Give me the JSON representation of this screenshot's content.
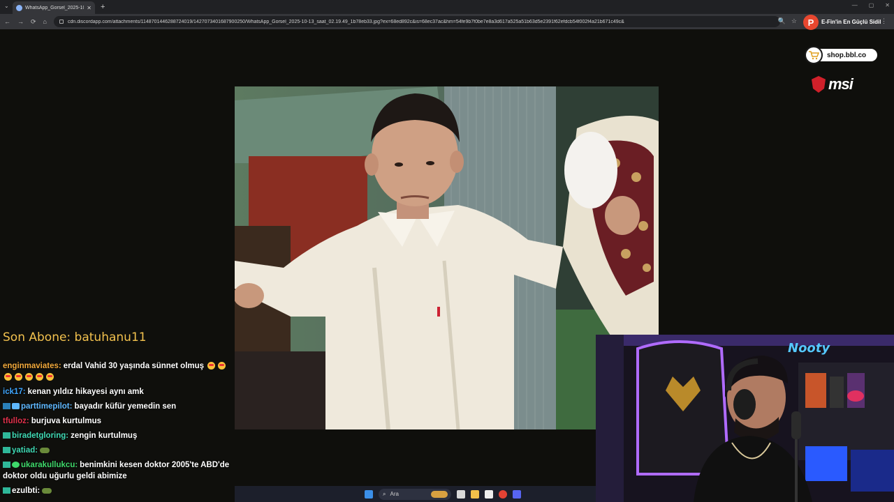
{
  "browser": {
    "tab_title": "WhatsApp_Gorsel_2025-10-13...",
    "tab_close": "✕",
    "new_tab": "+",
    "url": "cdn.discordapp.com/attachments/1148701446288724019/1427073401687900250/WhatsApp_Gorsel_2025-10-13_saat_02.19.49_1b78eb33.jpg?ex=68ed892c&is=68ec37ac&hm=54fe9b7f0be7e8a3d617a525a51b63d5e2391f62efdcb54f002f4a21b671c49c&",
    "back": "←",
    "forward": "→",
    "reload": "⟳",
    "home": "⌂",
    "zoom": "🔍",
    "star": "☆",
    "menu": "⋮",
    "win_min": "—",
    "win_max": "▢",
    "win_close": "✕"
  },
  "overlay": {
    "p_badge": "P",
    "p_text": "E-Fin'in En Güçlü Sidil",
    "shop": "shop.bbl.co",
    "msi": "msi"
  },
  "chat": {
    "son_abone": "Son Abone: batuhanu11",
    "messages": [
      {
        "user": "enginmaviates:",
        "color": "#f2a93b",
        "text": "erdal Vahid 30 yaşında sünnet olmuş"
      },
      {
        "user": "ick17:",
        "color": "#3ea6ff",
        "text": "kenan yıldız hikayesi aynı amk"
      },
      {
        "user": "parttimepilot:",
        "color": "#5fb8ff",
        "text": "bayadır küfür yemedin sen"
      },
      {
        "user": "tfulloz:",
        "color": "#e0314b",
        "text": "burjuva kurtulmus"
      },
      {
        "user": "biradetgloring:",
        "color": "#3fd9b4",
        "text": "zengin kurtulmuş"
      },
      {
        "user": "yatiad:",
        "color": "#3fd9b4",
        "text": ""
      },
      {
        "user": "ukarakullukcu:",
        "color": "#3fd96b",
        "text": "benimkini kesen doktor 2005'te ABD'de doktor oldu uğurlu geldi abimize"
      },
      {
        "user": "ezulbti:",
        "color": "#ffffff",
        "text": ""
      }
    ]
  },
  "taskbar": {
    "search_placeholder": "Ara"
  },
  "colors": {
    "background": "#0f0f0c",
    "son_abone": "#f2c14e",
    "msi_red": "#d0202a"
  }
}
